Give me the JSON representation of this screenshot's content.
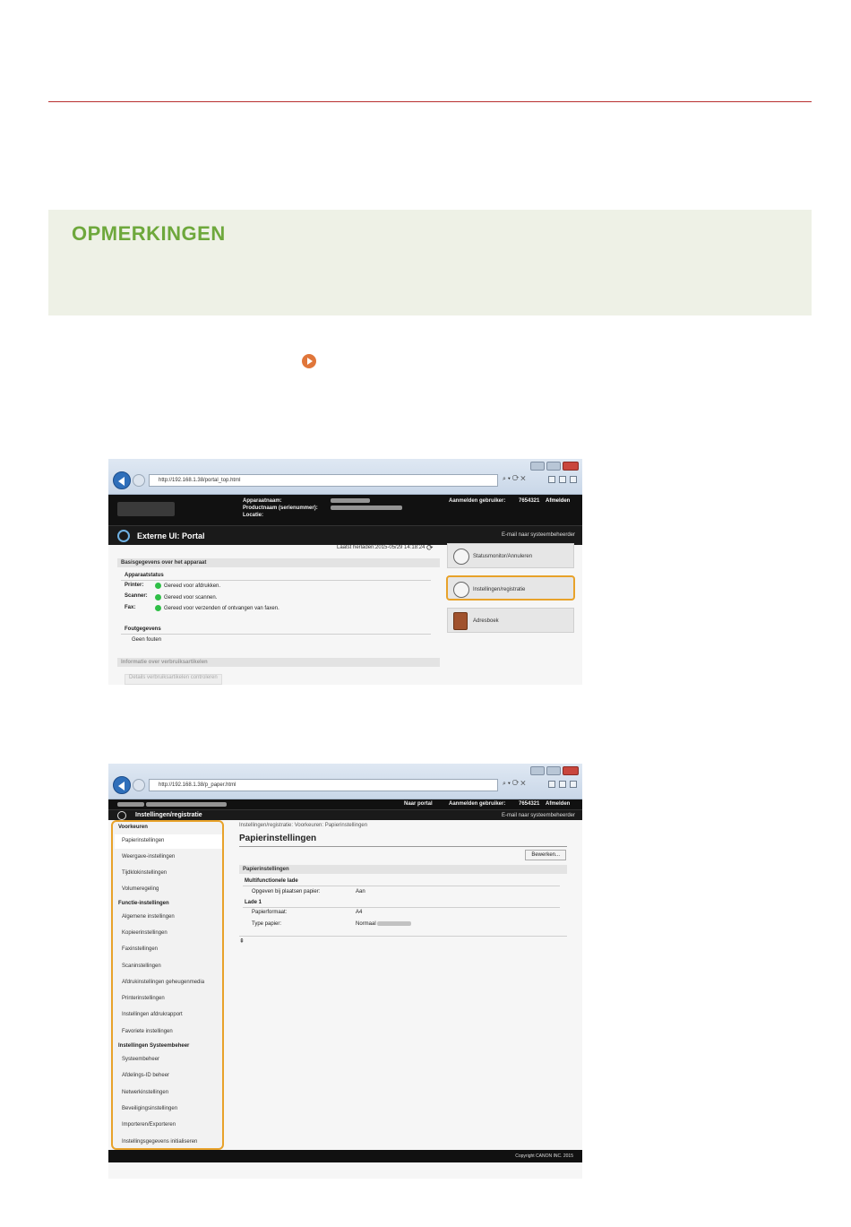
{
  "note": {
    "title": "OPMERKINGEN"
  },
  "shot1": {
    "address": "http://192.168.1.38/portal_top.html",
    "header": {
      "device_name_label": "Apparaatnaam:",
      "serial_label": "Productnaam (serienummer):",
      "location_label": "Locatie:",
      "login_user_label": "Aanmelden gebruiker:",
      "login_user_value": "7654321",
      "logout": "Afmelden"
    },
    "portal_title": "Externe UI: Portal",
    "mail_admin": "E-mail naar systeembeheerder",
    "last_updated": "Laatst herladen:2015-05/29 14:18:24",
    "basic_info_header": "Basisgegevens over het apparaat",
    "device_status_label": "Apparaatstatus",
    "status_rows": [
      {
        "label": "Printer:",
        "value": "Gereed voor afdrukken."
      },
      {
        "label": "Scanner:",
        "value": "Gereed voor scannen."
      },
      {
        "label": "Fax:",
        "value": "Gereed voor verzenden of ontvangen van faxen."
      }
    ],
    "error_info_label": "Foutgegevens",
    "error_value": "Geen fouten",
    "consumables_header": "Informatie over verbruiksartikelen",
    "consumables_button": "Details verbruiksartikelen controleren",
    "right_buttons": {
      "status_monitor": "Statusmonitor/Annuleren",
      "settings": "Instellingen/registratie",
      "address_book": "Adresboek"
    }
  },
  "shot2": {
    "address": "http://192.168.1.38/p_paper.html",
    "header": {
      "to_portal": "Naar portal",
      "login_user_label": "Aanmelden gebruiker:",
      "login_user_value": "7654321",
      "logout": "Afmelden"
    },
    "title": "Instellingen/registratie",
    "mail_admin": "E-mail naar systeembeheerder",
    "breadcrumb": "Instellingen/registratie: Voorkeuren: Papierinstellingen",
    "page_title": "Papierinstellingen",
    "edit_button": "Bewerken...",
    "section_header": "Papierinstellingen",
    "mp_tray": "Multifunctionele lade",
    "mp_rows": [
      {
        "label": "Opgeven bij plaatsen papier:",
        "value": "Aan"
      }
    ],
    "drawer": "Lade 1",
    "drawer_rows": [
      {
        "label": "Papierformaat:",
        "value": "A4"
      },
      {
        "label": "Type papier:",
        "value": "Normaal"
      }
    ],
    "copyright": "Copyright CANON INC. 2015",
    "menu": {
      "group1": "Voorkeuren",
      "group1_items": [
        "Papierinstellingen",
        "Weergave-instellingen",
        "Tijdklokinstellingen",
        "Volumeregeling"
      ],
      "group2": "Functie-instellingen",
      "group2_items": [
        "Algemene instellingen",
        "Kopieerinstellingen",
        "Faxinstellingen",
        "Scaninstellingen",
        "Afdrukinstellingen geheugenmedia",
        "Printerinstellingen",
        "Instellingen afdrukrapport",
        "Favoriete instellingen"
      ],
      "group3": "Instellingen Systeembeheer",
      "group3_items": [
        "Systeembeheer",
        "Afdelings-ID beheer",
        "Netwerkinstellingen",
        "Beveiligingsinstellingen",
        "Importeren/Exporteren",
        "Instellingsgegevens initialiseren"
      ]
    }
  }
}
